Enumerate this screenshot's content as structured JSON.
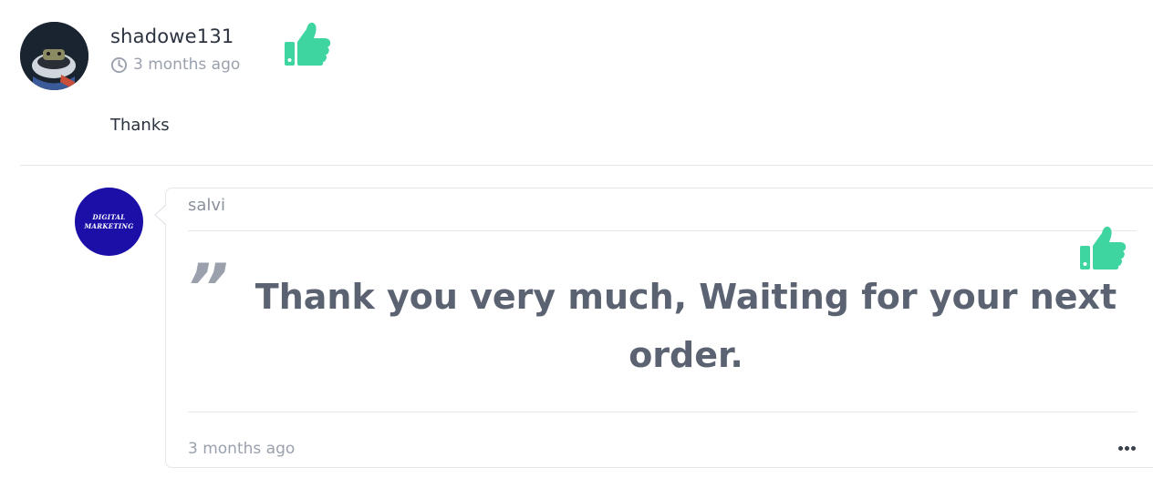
{
  "review": {
    "username": "shadowe131",
    "time_ago": "3 months ago",
    "text": "Thanks",
    "like_icon": "thumbs-up-icon",
    "clock_icon": "clock-icon"
  },
  "reply": {
    "seller_name": "salvi",
    "avatar_text_line1": "DIGITAL",
    "avatar_text_line2": "MARKETING",
    "quote_mark": "”",
    "text": "Thank you very much, Waiting for your next order.",
    "time_ago": "3 months ago",
    "like_icon": "thumbs-up-icon",
    "more_icon": "more-options-icon"
  },
  "colors": {
    "like_green": "#3fd5a0",
    "seller_avatar_bg": "#1b0fa8",
    "muted_text": "#9aa1ad",
    "reply_text": "#5b6372"
  }
}
